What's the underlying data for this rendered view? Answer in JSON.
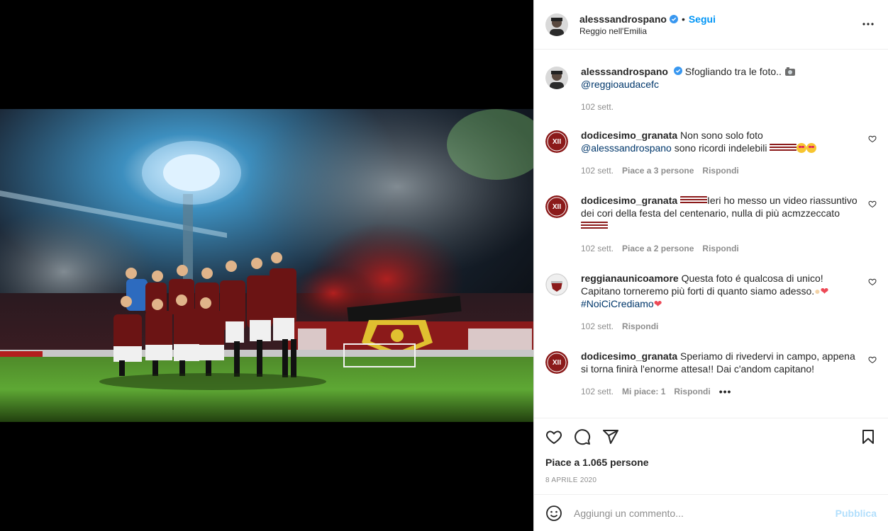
{
  "header": {
    "username": "alesssandrospano",
    "separator": "•",
    "follow_label": "Segui",
    "location": "Reggio nell'Emilia"
  },
  "caption": {
    "username": "alesssandrospano",
    "text": "Sfogliando tra le foto..",
    "mention": "@reggioaudacefc",
    "time": "102 sett."
  },
  "comments": [
    {
      "username": "dodicesimo_granata",
      "text_a": "Non sono solo foto",
      "mention": "@alesssandrospano",
      "text_b": "sono ricordi indelebili",
      "time": "102 sett.",
      "likes": "Piace a 3 persone",
      "reply": "Rispondi"
    },
    {
      "username": "dodicesimo_granata",
      "text": "Ieri ho messo un video riassuntivo dei cori della festa del centenario, nulla di più acmzzeccato",
      "time": "102 sett.",
      "likes": "Piace a 2 persone",
      "reply": "Rispondi"
    },
    {
      "username": "reggianaunicoamore",
      "text": "Questa foto é qualcosa di unico! Capitano torneremo più forti di quanto siamo adesso.",
      "hashtag": "#NoiCiCrediamo",
      "time": "102 sett.",
      "reply": "Rispondi"
    },
    {
      "username": "dodicesimo_granata",
      "text": "Speriamo di rivedervi in campo, appena si torna finirà l'enorme attesa!! Dai c'andom capitano!",
      "time": "102 sett.",
      "likes": "Mi piace: 1",
      "reply": "Rispondi",
      "more": "•••"
    }
  ],
  "likes_text": "Piace a 1.065 persone",
  "post_date": "8 APRILE 2020",
  "comment_placeholder": "Aggiungi un commento...",
  "publish_label": "Pubblica",
  "colors": {
    "accent": "#0095f6",
    "text": "#262626",
    "muted": "#8e8e8e",
    "granata": "#8b1a1a"
  }
}
